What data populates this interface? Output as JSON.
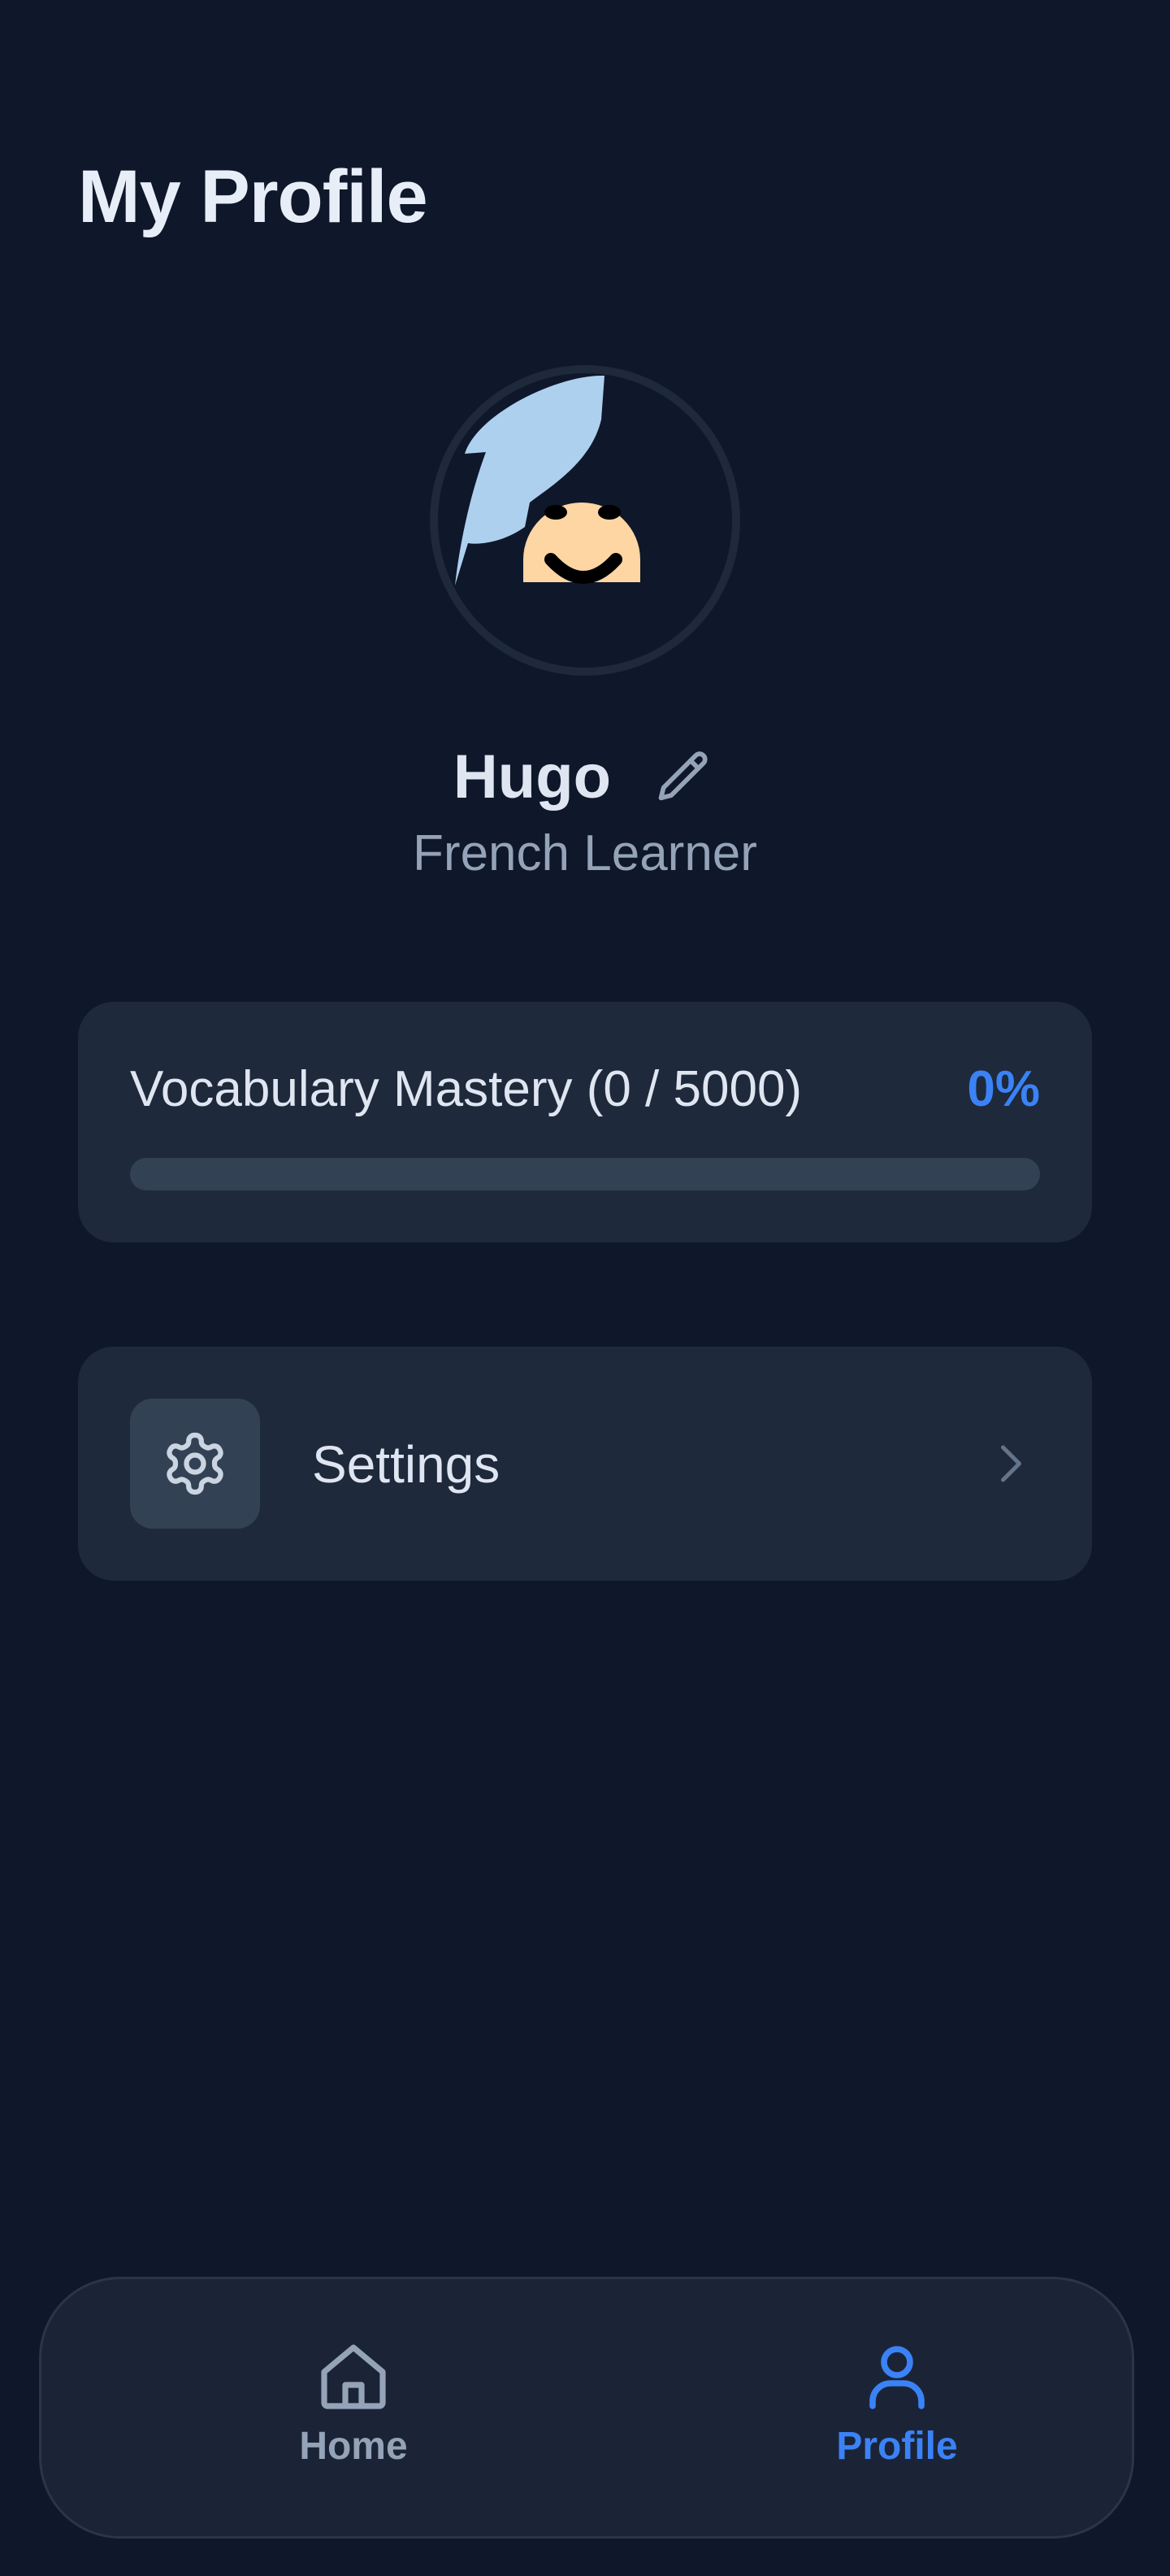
{
  "page": {
    "title": "My Profile"
  },
  "profile": {
    "name": "Hugo",
    "role": "French Learner"
  },
  "vocabulary": {
    "label": "Vocabulary Mastery (0 / 5000)",
    "mastered": 0,
    "total": 5000,
    "percent_label": "0%",
    "progress_fraction": 0
  },
  "menu": {
    "settings_label": "Settings"
  },
  "nav": {
    "items": [
      {
        "label": "Home",
        "icon": "home-icon",
        "active": false
      },
      {
        "label": "Profile",
        "icon": "user-icon",
        "active": true
      }
    ]
  },
  "colors": {
    "background": "#0f172a",
    "card": "#1e293b",
    "accent": "#3b82f6",
    "muted_text": "#94a3b8",
    "skin": "#fdd6a3",
    "hair": "#aed0ef"
  }
}
